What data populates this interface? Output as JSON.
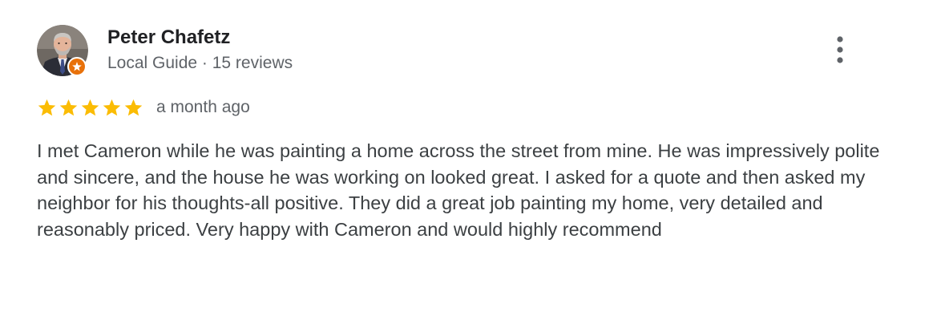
{
  "review": {
    "author": {
      "name": "Peter Chafetz",
      "meta": "Local Guide · 15 reviews",
      "avatar": "avatar-photo",
      "badge_icon": "local-guide-badge-icon"
    },
    "rating": {
      "stars": 5,
      "max": 5,
      "star_color": "#fbbc04",
      "date": "a month ago"
    },
    "text": "I met Cameron while he was painting a home across the street from mine. He was impressively polite and sincere, and the house he was working on looked great. I asked for a quote and then asked my neighbor for his thoughts-all positive. They did a great job painting my home, very detailed and reasonably priced. Very happy with Cameron and would highly recommend",
    "menu_icon": "more-vert-icon"
  },
  "colors": {
    "name": "#202124",
    "meta": "#5f6368",
    "body": "#3c4043",
    "badge": "#e8710a",
    "icon": "#5f6368"
  }
}
